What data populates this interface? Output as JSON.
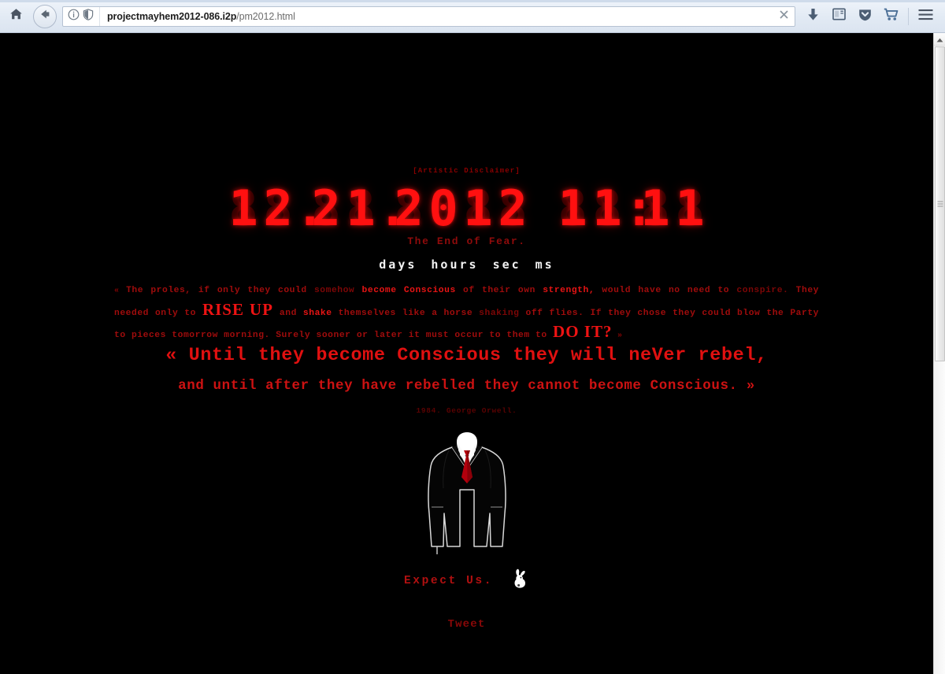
{
  "browser": {
    "url_host": "projectmayhem2012-086.i2p",
    "url_path": "/pm2012.html",
    "icons": {
      "home": "home-icon",
      "back": "back-arrow-icon",
      "identity_info": "info-circle-icon",
      "tracking_shield": "shield-icon",
      "stop": "stop-x-icon",
      "downloads": "download-arrow-icon",
      "reader": "reader-view-icon",
      "pocket": "pocket-icon",
      "cart": "shopping-cart-icon",
      "menu": "hamburger-menu-icon"
    }
  },
  "page": {
    "disclaimer": "[Artistic Disclaimer]",
    "clock": {
      "date_digits": [
        "1",
        "2",
        ".",
        "2",
        "1",
        ".",
        "2",
        "0",
        "1",
        "2"
      ],
      "time_digits": [
        "1",
        "1",
        ":",
        "1",
        "1"
      ],
      "date_display": "12.21.2012",
      "time_display": "11:11",
      "off_color": "#300000",
      "on_color": "#ff1010"
    },
    "tagline": "The End of Fear.",
    "units": [
      "days",
      "hours",
      "sec",
      "ms"
    ],
    "orwell_paragraph": {
      "open_quote": "«",
      "close_quote": "»",
      "segments": [
        {
          "text": "The proles, if only they could ",
          "style": "normal"
        },
        {
          "text": "somehow",
          "style": "dim"
        },
        {
          "text": " ",
          "style": "normal"
        },
        {
          "text": "become",
          "style": "bright"
        },
        {
          "text": " ",
          "style": "normal"
        },
        {
          "text": "Conscious",
          "style": "bright"
        },
        {
          "text": " of their own ",
          "style": "normal"
        },
        {
          "text": "strength,",
          "style": "bright"
        },
        {
          "text": " would have no need to ",
          "style": "normal"
        },
        {
          "text": "conspire.",
          "style": "dim"
        },
        {
          "text": " They needed only to ",
          "style": "normal"
        },
        {
          "text": "RISE UP",
          "style": "big"
        },
        {
          "text": " and ",
          "style": "normal"
        },
        {
          "text": "shake",
          "style": "bright"
        },
        {
          "text": " themselves like a horse ",
          "style": "normal"
        },
        {
          "text": "shaking",
          "style": "dim"
        },
        {
          "text": " off flies. If they chose they could blow the Party to pieces tomorrow morning. Surely sooner or later it must occur to them to ",
          "style": "normal"
        },
        {
          "text": "DO IT",
          "style": "big"
        },
        {
          "text": "?",
          "style": "big"
        }
      ],
      "plain": "« The proles, if only they could somehow become Conscious of their own strength, would have no need to conspire. They needed only to RISE UP and shake themselves like a horse shaking off flies. If they chose they could blow the Party to pieces tomorrow morning. Surely sooner or later it must occur to them to DO IT? »"
    },
    "quote_line_1": "« Until they become Conscious they will neVer rebel,",
    "quote_line_2": "and until after they have rebelled they cannot become Conscious. »",
    "attribution": "1984. George Orwell.",
    "anon_logo_name": "anonymous-suit-logo",
    "expect_us": "Expect Us.",
    "rabbit_icon_name": "white-rabbit-icon",
    "tweet_label": "Tweet"
  }
}
